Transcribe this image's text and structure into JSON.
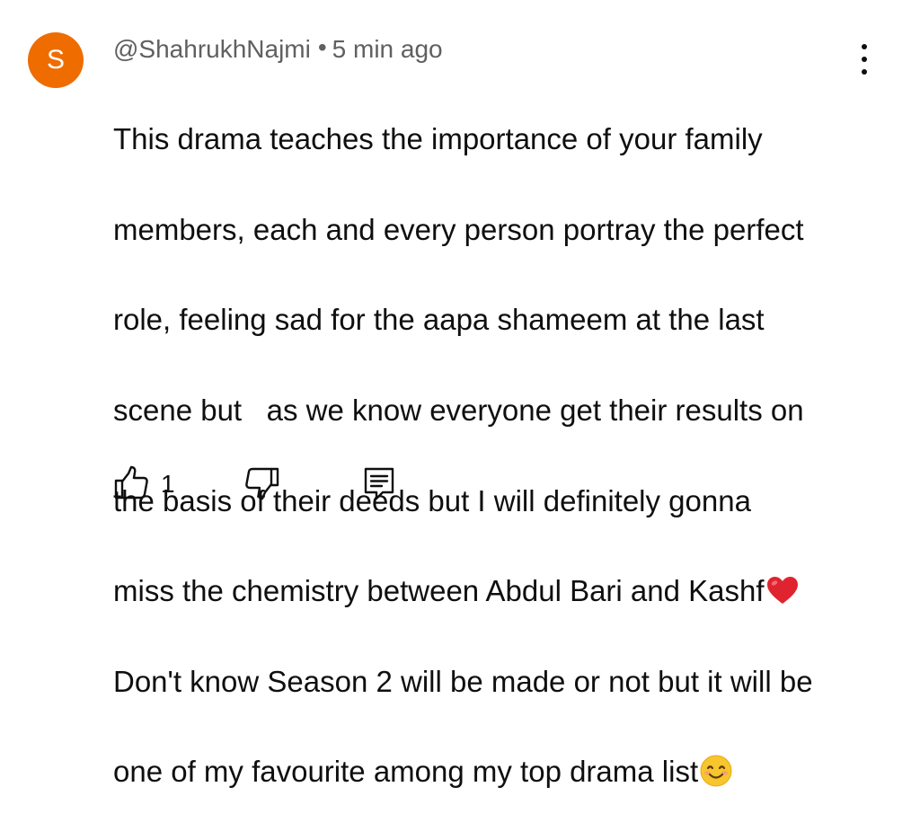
{
  "comment": {
    "avatar_letter": "S",
    "avatar_color": "#ef6c00",
    "author": "@ShahrukhNajmi",
    "separator": "•",
    "time": "5 min ago",
    "text_lines": [
      "This drama teaches the importance of your family",
      "members, each and every person portray the perfect",
      "role, feeling sad for the aapa shameem at the last",
      "scene but   as we know everyone get their results on",
      "the basis of their deeds but I will definitely gonna",
      "miss the chemistry between Abdul Bari and Kashf",
      "Don't know Season 2 will be made or not but it will be",
      "one of my favourite among my top drama list"
    ],
    "like_count": "1"
  },
  "icons": {
    "more": "more-vertical-icon",
    "like": "thumbs-up-icon",
    "dislike": "thumbs-down-icon",
    "reply": "reply-comment-icon",
    "heart": "red-heart-emoji",
    "smile": "smiling-face-emoji"
  },
  "colors": {
    "text": "#0f0f0f",
    "meta": "#606060",
    "heart": "#e0242f",
    "smile": "#f7c52c"
  }
}
